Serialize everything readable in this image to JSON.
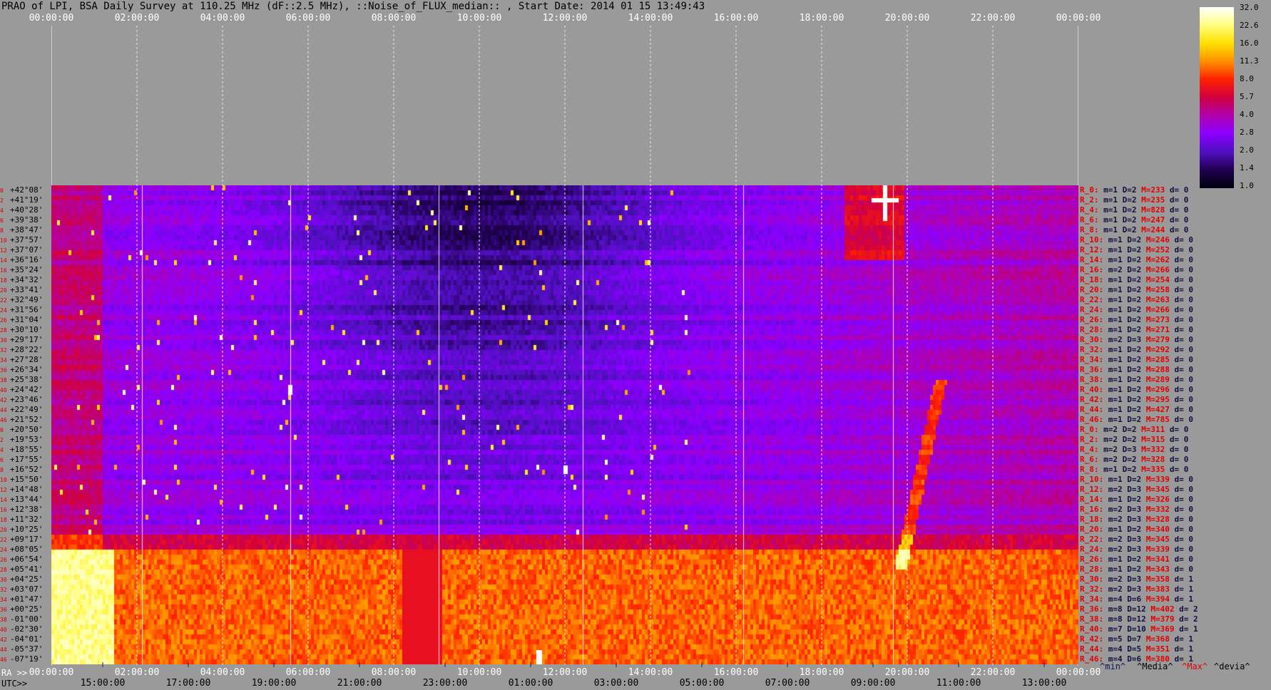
{
  "title": "PRAO of LPI, BSA Daily Survey at 110.25 MHz (dF::2.5 MHz), ::Noise_of_FLUX_median:: , Start Date: 2014 01 15 13:49:43",
  "top_axis": [
    "00:00:00",
    "02:00:00",
    "04:00:00",
    "06:00:00",
    "08:00:00",
    "10:00:00",
    "12:00:00",
    "14:00:00",
    "16:00:00",
    "18:00:00",
    "20:00:00",
    "22:00:00",
    "00:00:00"
  ],
  "ra_label": "RA >>",
  "bottom_axis": [
    "00:00:00",
    "02:00:00",
    "04:00:00",
    "06:00:00",
    "08:00:00",
    "10:00:00",
    "12:00:00",
    "14:00:00",
    "16:00:00",
    "18:00:00",
    "20:00:00",
    "22:00:00",
    "00:00:00"
  ],
  "utc_label": "UTC>>",
  "utc_axis": [
    "15:00:00",
    "17:00:00",
    "19:00:00",
    "21:00:00",
    "23:00:00",
    "01:00:00",
    "03:00:00",
    "05:00:00",
    "07:00:00",
    "09:00:00",
    "11:00:00",
    "13:00:00"
  ],
  "colorbar": {
    "ticks": [
      "32.0",
      "22.6",
      "16.0",
      "11.3",
      "8.0",
      "5.7",
      "4.0",
      "2.8",
      "2.0",
      "1.4",
      "1.0"
    ],
    "colors": [
      "#ffffff",
      "#ffff80",
      "#ffe000",
      "#ff9000",
      "#ff2000",
      "#d00040",
      "#b000b0",
      "#8a00ff",
      "#5010c0",
      "#200050",
      "#000010"
    ]
  },
  "declinations": [
    "+42°08'",
    "+41°19'",
    "+40°28'",
    "+39°38'",
    "+38°47'",
    "+37°57'",
    "+37°07'",
    "+36°16'",
    "+35°24'",
    "+34°32'",
    "+33°41'",
    "+32°49'",
    "+31°56'",
    "+31°04'",
    "+30°10'",
    "+29°17'",
    "+28°22'",
    "+27°28'",
    "+26°34'",
    "+25°38'",
    "+24°42'",
    "+23°46'",
    "+22°49'",
    "+21°52'",
    "+20°50'",
    "+19°53'",
    "+18°55'",
    "+17°55'",
    "+16°52'",
    "+15°50'",
    "+14°48'",
    "+13°44'",
    "+12°38'",
    "+11°32'",
    "+10°25'",
    "+09°17'",
    "+08°05'",
    "+06°54'",
    "+05°41'",
    "+04°25'",
    "+03°07'",
    "+01°47'",
    "+00°25'",
    "-01°00'",
    "-02°30'",
    "-04°01'",
    "-05°37'",
    "-07°19'"
  ],
  "row_index_labels": [
    "0",
    "2",
    "4",
    "6",
    "8",
    "10",
    "12",
    "14",
    "16",
    "18",
    "20",
    "22",
    "24",
    "26",
    "28",
    "30",
    "32",
    "34",
    "36",
    "38",
    "40",
    "42",
    "44",
    "46",
    "0",
    "2",
    "4",
    "6",
    "8",
    "10",
    "12",
    "14",
    "16",
    "18",
    "20",
    "22",
    "24",
    "26",
    "28",
    "30",
    "32",
    "34",
    "36",
    "38",
    "40",
    "42",
    "44",
    "46"
  ],
  "stats": [
    {
      "r": "R_0:",
      "m": "m=1 D=2",
      "M": "M=233",
      "d": "d= 0"
    },
    {
      "r": "R_2:",
      "m": "m=1 D=2",
      "M": "M=235",
      "d": "d= 0"
    },
    {
      "r": "R_4:",
      "m": "m=1 D=2",
      "M": "M=828",
      "d": "d= 0"
    },
    {
      "r": "R_6:",
      "m": "m=1 D=2",
      "M": "M=247",
      "d": "d= 0"
    },
    {
      "r": "R_8:",
      "m": "m=1 D=2",
      "M": "M=244",
      "d": "d= 0"
    },
    {
      "r": "R_10:",
      "m": "m=1 D=2",
      "M": "M=246",
      "d": "d= 0"
    },
    {
      "r": "R_12:",
      "m": "m=1 D=2",
      "M": "M=252",
      "d": "d= 0"
    },
    {
      "r": "R_14:",
      "m": "m=1 D=2",
      "M": "M=262",
      "d": "d= 0"
    },
    {
      "r": "R_16:",
      "m": "m=2 D=2",
      "M": "M=266",
      "d": "d= 0"
    },
    {
      "r": "R_18:",
      "m": "m=1 D=2",
      "M": "M=254",
      "d": "d= 0"
    },
    {
      "r": "R_20:",
      "m": "m=1 D=2",
      "M": "M=258",
      "d": "d= 0"
    },
    {
      "r": "R_22:",
      "m": "m=1 D=2",
      "M": "M=263",
      "d": "d= 0"
    },
    {
      "r": "R_24:",
      "m": "m=1 D=2",
      "M": "M=266",
      "d": "d= 0"
    },
    {
      "r": "R_26:",
      "m": "m=1 D=2",
      "M": "M=273",
      "d": "d= 0"
    },
    {
      "r": "R_28:",
      "m": "m=1 D=2",
      "M": "M=271",
      "d": "d= 0"
    },
    {
      "r": "R_30:",
      "m": "m=2 D=3",
      "M": "M=279",
      "d": "d= 0"
    },
    {
      "r": "R_32:",
      "m": "m=1 D=2",
      "M": "M=292",
      "d": "d= 0"
    },
    {
      "r": "R_34:",
      "m": "m=1 D=2",
      "M": "M=285",
      "d": "d= 0"
    },
    {
      "r": "R_36:",
      "m": "m=1 D=2",
      "M": "M=288",
      "d": "d= 0"
    },
    {
      "r": "R_38:",
      "m": "m=1 D=2",
      "M": "M=289",
      "d": "d= 0"
    },
    {
      "r": "R_40:",
      "m": "m=1 D=2",
      "M": "M=296",
      "d": "d= 0"
    },
    {
      "r": "R_42:",
      "m": "m=1 D=2",
      "M": "M=295",
      "d": "d= 0"
    },
    {
      "r": "R_44:",
      "m": "m=1 D=2",
      "M": "M=427",
      "d": "d= 0"
    },
    {
      "r": "R_46:",
      "m": "m=1 D=2",
      "M": "M=785",
      "d": "d= 0"
    },
    {
      "r": "R_0:",
      "m": "m=2 D=2",
      "M": "M=311",
      "d": "d= 0"
    },
    {
      "r": "R_2:",
      "m": "m=2 D=2",
      "M": "M=315",
      "d": "d= 0"
    },
    {
      "r": "R_4:",
      "m": "m=2 D=3",
      "M": "M=332",
      "d": "d= 0"
    },
    {
      "r": "R_6:",
      "m": "m=2 D=2",
      "M": "M=328",
      "d": "d= 0"
    },
    {
      "r": "R_8:",
      "m": "m=1 D=2",
      "M": "M=335",
      "d": "d= 0"
    },
    {
      "r": "R_10:",
      "m": "m=1 D=2",
      "M": "M=339",
      "d": "d= 0"
    },
    {
      "r": "R_12:",
      "m": "m=2 D=3",
      "M": "M=345",
      "d": "d= 0"
    },
    {
      "r": "R_14:",
      "m": "m=1 D=2",
      "M": "M=326",
      "d": "d= 0"
    },
    {
      "r": "R_16:",
      "m": "m=2 D=3",
      "M": "M=332",
      "d": "d= 0"
    },
    {
      "r": "R_18:",
      "m": "m=2 D=3",
      "M": "M=328",
      "d": "d= 0"
    },
    {
      "r": "R_20:",
      "m": "m=1 D=2",
      "M": "M=340",
      "d": "d= 0"
    },
    {
      "r": "R_22:",
      "m": "m=2 D=3",
      "M": "M=345",
      "d": "d= 0"
    },
    {
      "r": "R_24:",
      "m": "m=2 D=3",
      "M": "M=339",
      "d": "d= 0"
    },
    {
      "r": "R_26:",
      "m": "m=1 D=2",
      "M": "M=341",
      "d": "d= 0"
    },
    {
      "r": "R_28:",
      "m": "m=1 D=2",
      "M": "M=343",
      "d": "d= 0"
    },
    {
      "r": "R_30:",
      "m": "m=2 D=3",
      "M": "M=358",
      "d": "d= 1"
    },
    {
      "r": "R_32:",
      "m": "m=2 D=3",
      "M": "M=383",
      "d": "d= 1"
    },
    {
      "r": "R_34:",
      "m": "m=4 D=6",
      "M": "M=394",
      "d": "d= 1"
    },
    {
      "r": "R_36:",
      "m": "m=8 D=12",
      "M": "M=402",
      "d": "d= 2"
    },
    {
      "r": "R_38:",
      "m": "m=8 D=12",
      "M": "M=379",
      "d": "d= 2"
    },
    {
      "r": "R_40:",
      "m": "m=7 D=10",
      "M": "M=369",
      "d": "d= 1"
    },
    {
      "r": "R_42:",
      "m": "m=5 D=7",
      "M": "M=368",
      "d": "d= 1"
    },
    {
      "r": "R_44:",
      "m": "m=4 D=5",
      "M": "M=351",
      "d": "d= 1"
    },
    {
      "r": "R_46:",
      "m": "m=4 D=6",
      "M": "M=380",
      "d": "d= 1"
    }
  ],
  "legend": {
    "min": "^min^",
    "median": "^Media^",
    "max": "^Max^",
    "devia": "^devia^"
  }
}
